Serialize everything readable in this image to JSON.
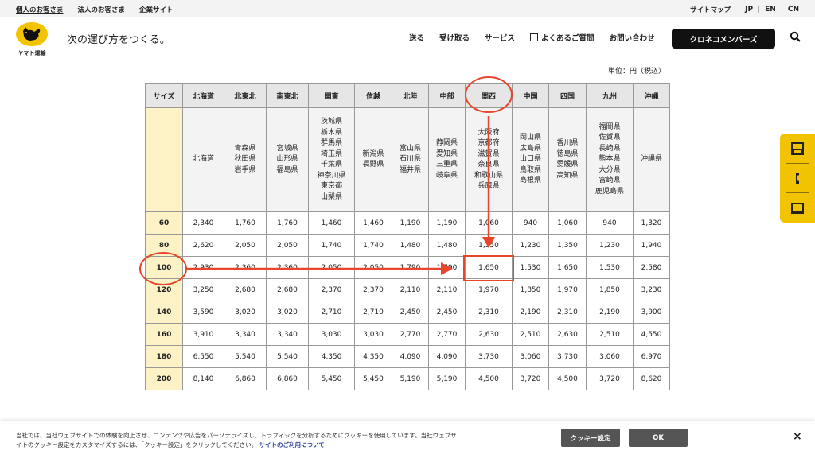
{
  "utility": {
    "left_links": [
      "個人のお客さま",
      "法人のお客さま",
      "企業サイト"
    ],
    "sitemap": "サイトマップ",
    "langs": [
      "JP",
      "EN",
      "CN"
    ]
  },
  "header": {
    "logo_text": "ヤマト運輸",
    "tagline": "次の運び方をつくる。",
    "nav": [
      "送る",
      "受け取る",
      "サービス",
      "よくあるご質問",
      "お問い合わせ"
    ],
    "member_button": "クロネコメンバーズ"
  },
  "unit_note": "単位：円（税込）",
  "table": {
    "headers": [
      "サイズ",
      "北海道",
      "北東北",
      "南東北",
      "関東",
      "信越",
      "北陸",
      "中部",
      "関西",
      "中国",
      "四国",
      "九州",
      "沖縄"
    ],
    "prefectures": [
      "",
      "北海道",
      "青森県\n秋田県\n岩手県",
      "宮城県\n山形県\n福島県",
      "茨城県\n栃木県\n群馬県\n埼玉県\n千葉県\n神奈川県\n東京都\n山梨県",
      "新潟県\n長野県",
      "富山県\n石川県\n福井県",
      "静岡県\n愛知県\n三重県\n岐阜県",
      "大阪府\n京都府\n滋賀県\n奈良県\n和歌山県\n兵庫県",
      "岡山県\n広島県\n山口県\n鳥取県\n島根県",
      "香川県\n徳島県\n愛媛県\n高知県",
      "福岡県\n佐賀県\n長崎県\n熊本県\n大分県\n宮崎県\n鹿児島県",
      "沖縄県"
    ],
    "rows": [
      [
        "60",
        "2,340",
        "1,760",
        "1,760",
        "1,460",
        "1,460",
        "1,190",
        "1,190",
        "1,060",
        "940",
        "1,060",
        "940",
        "1,320"
      ],
      [
        "80",
        "2,620",
        "2,050",
        "2,050",
        "1,740",
        "1,740",
        "1,480",
        "1,480",
        "1,350",
        "1,230",
        "1,350",
        "1,230",
        "1,940"
      ],
      [
        "100",
        "2,930",
        "2,360",
        "2,360",
        "2,050",
        "2,050",
        "1,790",
        "1,790",
        "1,650",
        "1,530",
        "1,650",
        "1,530",
        "2,580"
      ],
      [
        "120",
        "3,250",
        "2,680",
        "2,680",
        "2,370",
        "2,370",
        "2,110",
        "2,110",
        "1,970",
        "1,850",
        "1,970",
        "1,850",
        "3,230"
      ],
      [
        "140",
        "3,590",
        "3,020",
        "3,020",
        "2,710",
        "2,710",
        "2,450",
        "2,450",
        "2,310",
        "2,190",
        "2,310",
        "2,190",
        "3,900"
      ],
      [
        "160",
        "3,910",
        "3,340",
        "3,340",
        "3,030",
        "3,030",
        "2,770",
        "2,770",
        "2,630",
        "2,510",
        "2,630",
        "2,510",
        "4,550"
      ],
      [
        "180",
        "6,550",
        "5,540",
        "5,540",
        "4,350",
        "4,350",
        "4,090",
        "4,090",
        "3,730",
        "3,060",
        "3,730",
        "3,060",
        "6,970"
      ],
      [
        "200",
        "8,140",
        "6,860",
        "6,860",
        "5,450",
        "5,450",
        "5,190",
        "5,190",
        "4,500",
        "3,720",
        "4,500",
        "3,720",
        "8,620"
      ]
    ]
  },
  "colors": {
    "brand_yellow": "#f2c300",
    "annotation_red": "#e8452c",
    "size_cell": "#fcf2c5"
  },
  "side_icons": [
    "printer-icon",
    "phone-icon",
    "computer-icon"
  ],
  "cookie": {
    "text": "当社では、当社ウェブサイトでの体験を向上させ、コンテンツや広告をパーソナライズし、トラフィックを分析するためにクッキーを使用しています。当社ウェブサイトのクッキー設定をカスタマイズするには、「クッキー設定」をクリックしてください。",
    "link": "サイトのご利用について",
    "settings_button": "クッキー設定",
    "ok_button": "OK",
    "close": "×"
  }
}
